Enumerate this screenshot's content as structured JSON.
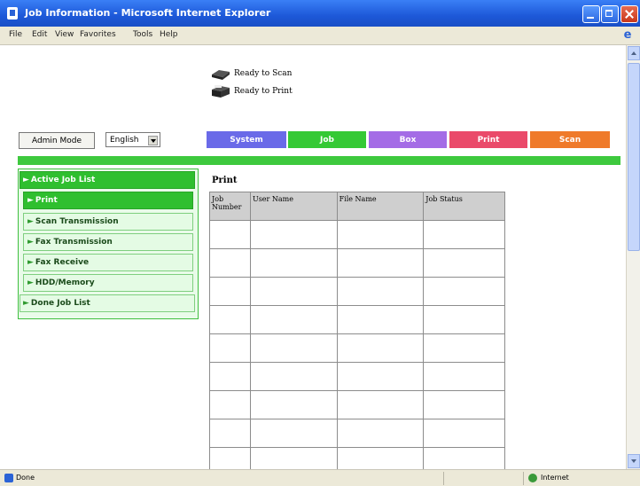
{
  "window": {
    "title": "Job Information - Microsoft Internet Explorer"
  },
  "menu": [
    "File",
    "Edit",
    "View",
    "Favorites",
    "Tools",
    "Help"
  ],
  "device_status": {
    "scan": "Ready to Scan",
    "print": "Ready to Print"
  },
  "controls": {
    "admin_mode": "Admin Mode",
    "language": "English"
  },
  "tabs": [
    {
      "label": "System",
      "color": "#6a6ae8"
    },
    {
      "label": "Job",
      "color": "#35c935"
    },
    {
      "label": "Box",
      "color": "#a46ce6"
    },
    {
      "label": "Print",
      "color": "#ea4a6a"
    },
    {
      "label": "Scan",
      "color": "#ef7a2a"
    }
  ],
  "accent_color": "#3ec93e",
  "sidebar": {
    "items": [
      {
        "label": "Active Job List",
        "active": true
      },
      {
        "label": "Print",
        "active": true
      },
      {
        "label": "Scan Transmission",
        "active": false
      },
      {
        "label": "Fax Transmission",
        "active": false
      },
      {
        "label": "Fax Receive",
        "active": false
      },
      {
        "label": "HDD/Memory",
        "active": false
      },
      {
        "label": "Done Job List",
        "active": false
      }
    ]
  },
  "main": {
    "section_title": "Print",
    "table": {
      "columns": [
        "Job Number",
        "User Name",
        "File Name",
        "Job Status"
      ],
      "rows": [
        [
          "",
          "",
          "",
          ""
        ],
        [
          "",
          "",
          "",
          ""
        ],
        [
          "",
          "",
          "",
          ""
        ],
        [
          "",
          "",
          "",
          ""
        ],
        [
          "",
          "",
          "",
          ""
        ],
        [
          "",
          "",
          "",
          ""
        ],
        [
          "",
          "",
          "",
          ""
        ],
        [
          "",
          "",
          "",
          ""
        ],
        [
          "",
          "",
          "",
          ""
        ],
        [
          "",
          "",
          "",
          ""
        ]
      ]
    }
  },
  "statusbar": {
    "left": "Done",
    "zone": "Internet"
  }
}
